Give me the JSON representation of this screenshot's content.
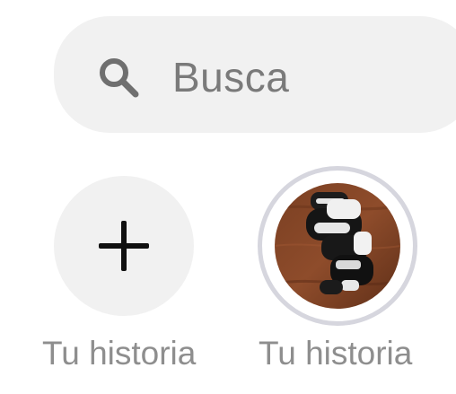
{
  "search": {
    "placeholder": "Busca",
    "icon": "search-icon"
  },
  "stories": [
    {
      "label": "Tu historia",
      "icon": "plus-icon"
    },
    {
      "label": "Tu historia",
      "image": "boxing-glove-photo"
    }
  ],
  "colors": {
    "surface": "#f1f1f1",
    "placeholder_text": "#7a7a7a",
    "label_text": "#8e8e8e",
    "story_ring": "#d6d6de"
  }
}
